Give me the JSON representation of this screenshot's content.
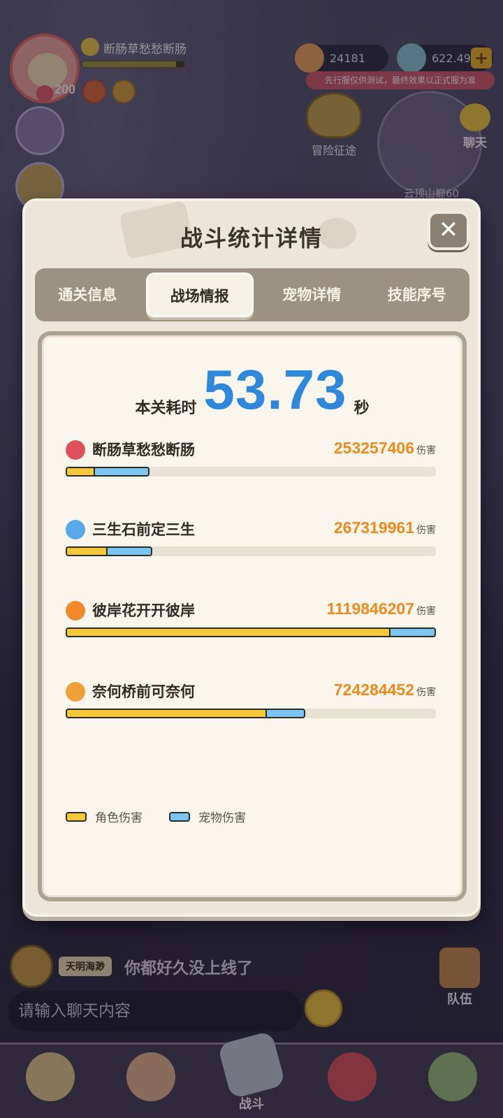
{
  "hud": {
    "player_name": "断肠草愁愁断肠",
    "level": "200",
    "currency_gold": "24181",
    "currency_gem": "622.49M",
    "plus_label": "+",
    "test_notice": "先行服仅供测试，最终效果以正式服为准",
    "expedition_label": "冒险征途",
    "chat_label": "聊天",
    "map_label": "云顶山巅60"
  },
  "dialog": {
    "title": "战斗统计详情",
    "close_label": "✕",
    "tabs": [
      {
        "label": "通关信息",
        "active": false
      },
      {
        "label": "战场情报",
        "active": true
      },
      {
        "label": "宠物详情",
        "active": false
      },
      {
        "label": "技能序号",
        "active": false
      }
    ],
    "time": {
      "label": "本关耗时",
      "value": "53.73",
      "unit": "秒"
    },
    "damage_unit": "伤害",
    "players": [
      {
        "name": "断肠草愁愁断肠",
        "damage": "253257406",
        "role_ratio": 0.075,
        "pet_ratio": 0.15,
        "icon": "crossed-swords-icon",
        "icon_color": "#e0505a"
      },
      {
        "name": "三生石前定三生",
        "damage": "267319961",
        "role_ratio": 0.11,
        "pet_ratio": 0.125,
        "icon": "frost-swirl-icon",
        "icon_color": "#5aa8e8"
      },
      {
        "name": "彼岸花开开彼岸",
        "damage": "1119846207",
        "role_ratio": 0.873,
        "pet_ratio": 0.127,
        "icon": "arrow-bow-icon",
        "icon_color": "#f08a2a"
      },
      {
        "name": "奈何桥前可奈何",
        "damage": "724284452",
        "role_ratio": 0.54,
        "pet_ratio": 0.107,
        "icon": "flame-claw-icon",
        "icon_color": "#f0a03a"
      }
    ],
    "legend": {
      "role": "角色伤害",
      "pet": "宠物伤害"
    }
  },
  "chat": {
    "sender": "天明海渺",
    "message": "你都好久没上线了",
    "input_placeholder": "请输入聊天内容",
    "team_label": "队伍"
  },
  "nav": {
    "items": [
      {
        "name": "nav-character",
        "label": "",
        "color": "#e8c98a"
      },
      {
        "name": "nav-hero",
        "label": "",
        "color": "#e7b58c"
      },
      {
        "name": "nav-battle",
        "label": "战斗",
        "color": "#c4c8d4"
      },
      {
        "name": "nav-pet",
        "label": "",
        "color": "#e0505a"
      },
      {
        "name": "nav-tribe",
        "label": "",
        "color": "#9ec07a"
      }
    ]
  },
  "colors": {
    "role_bar": "#f5c83c",
    "pet_bar": "#7cc5f0",
    "time_value": "#2f88d8",
    "damage_number": "#ef8a1c"
  }
}
